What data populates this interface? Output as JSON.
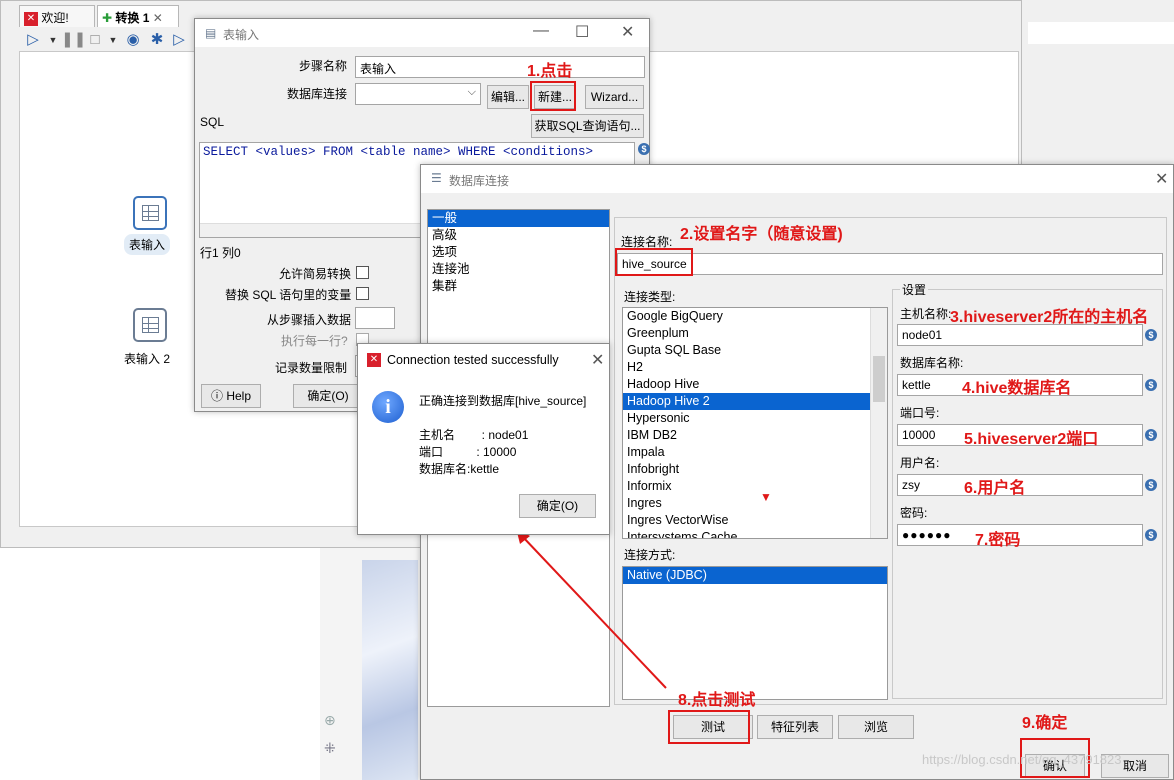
{
  "app": {
    "tabs": [
      {
        "label": "欢迎!"
      },
      {
        "label": "转换 1"
      }
    ],
    "steps": [
      {
        "label": "表输入"
      },
      {
        "label": "表输入 2"
      }
    ]
  },
  "table_input": {
    "title": "表输入",
    "step_name_label": "步骤名称",
    "step_name_value": "表输入",
    "db_conn_label": "数据库连接",
    "edit_btn": "编辑...",
    "new_btn": "新建...",
    "wizard_btn": "Wizard...",
    "sql_label": "SQL",
    "get_sql_btn": "获取SQL查询语句...",
    "sql_text": "SELECT <values> FROM <table name> WHERE <conditions>",
    "row_col": "行1 列0",
    "opt_lazy": "允许简易转换",
    "opt_replace": "替换 SQL 语句里的变量",
    "opt_insert": "从步骤插入数据",
    "opt_each_row": "执行每一行?",
    "opt_limit": "记录数量限制",
    "help_btn": "Help",
    "ok_btn": "确定(O)"
  },
  "db_conn": {
    "title": "数据库连接",
    "nav": [
      "一般",
      "高级",
      "选项",
      "连接池",
      "集群"
    ],
    "conn_name_label": "连接名称:",
    "conn_name_value": "hive_source",
    "conn_type_label": "连接类型:",
    "conn_types": [
      "Google BigQuery",
      "Greenplum",
      "Gupta SQL Base",
      "H2",
      "Hadoop Hive",
      "Hadoop Hive 2",
      "Hypersonic",
      "IBM DB2",
      "Impala",
      "Infobright",
      "Informix",
      "Ingres",
      "Ingres VectorWise",
      "Intersystems Cache"
    ],
    "selected_type": "Hadoop Hive 2",
    "access_label": "连接方式:",
    "access_value": "Native (JDBC)",
    "settings_label": "设置",
    "host_label": "主机名称:",
    "host_value": "node01",
    "dbname_label": "数据库名称:",
    "dbname_value": "kettle",
    "port_label": "端口号:",
    "port_value": "10000",
    "user_label": "用户名:",
    "user_value": "zsy",
    "pwd_label": "密码:",
    "pwd_value": "●●●●●●",
    "test_btn": "测试",
    "features_btn": "特征列表",
    "browse_btn": "浏览",
    "ok_btn": "确认",
    "cancel_btn": "取消"
  },
  "conn_test": {
    "title": "Connection tested successfully",
    "message": "正确连接到数据库[hive_source]",
    "host_line": "主机名        : node01",
    "port_line": "端口          : 10000",
    "db_line": "数据库名:kettle",
    "ok_btn": "确定(O)"
  },
  "annotations": {
    "a1": "1.点击",
    "a2": "2.设置名字（随意设置)",
    "a3": "3.hiveserver2所在的主机名",
    "a4": "4.hive数据库名",
    "a5": "5.hiveserver2端口",
    "a6": "6.用户名",
    "a7": "7.密码",
    "a8": "8.点击测试",
    "a9": "9.确定"
  },
  "watermark": "https://blog.csdn.net/qq_43791823"
}
